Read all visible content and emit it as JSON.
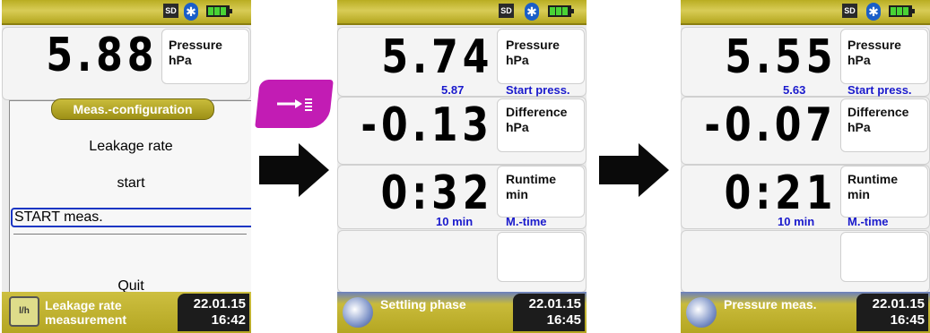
{
  "screen1": {
    "pressure": {
      "value": "5.88",
      "label1": "Pressure",
      "label2": "hPa"
    },
    "menu": {
      "title": "Meas.-configuration",
      "items": [
        "Leakage rate",
        "start",
        "START meas.",
        "Quit"
      ]
    },
    "bottom": {
      "status_line1": "Leakage rate",
      "status_line2": "measurement",
      "date": "22.01.15",
      "time": "16:42"
    }
  },
  "screen2": {
    "pressure": {
      "value": "5.74",
      "label1": "Pressure",
      "label2": "hPa",
      "sub_value": "5.87",
      "sub_label": "Start press."
    },
    "difference": {
      "value": "-0.13",
      "label1": "Difference",
      "label2": "hPa"
    },
    "runtime": {
      "value": "0:32",
      "label1": "Runtime",
      "label2": "min",
      "sub_value": "10 min",
      "sub_label": "M.-time"
    },
    "bottom": {
      "status": "Settling phase",
      "date": "22.01.15",
      "time": "16:45"
    }
  },
  "screen3": {
    "pressure": {
      "value": "5.55",
      "label1": "Pressure",
      "label2": "hPa",
      "sub_value": "5.63",
      "sub_label": "Start press."
    },
    "difference": {
      "value": "-0.07",
      "label1": "Difference",
      "label2": "hPa"
    },
    "runtime": {
      "value": "0:21",
      "label1": "Runtime",
      "label2": "min",
      "sub_value": "10 min",
      "sub_label": "M.-time"
    },
    "bottom": {
      "status": "Pressure meas.",
      "date": "22.01.15",
      "time": "16:45"
    }
  },
  "status_icons": {
    "sd": "SD",
    "bluetooth": "bluetooth-icon",
    "battery": "battery-icon"
  },
  "softkey": {
    "icon": "start-list-icon",
    "color": "#c21cb4"
  },
  "colors": {
    "bar_yellow": "#c6b832",
    "sub_blue": "#1a1acc"
  }
}
